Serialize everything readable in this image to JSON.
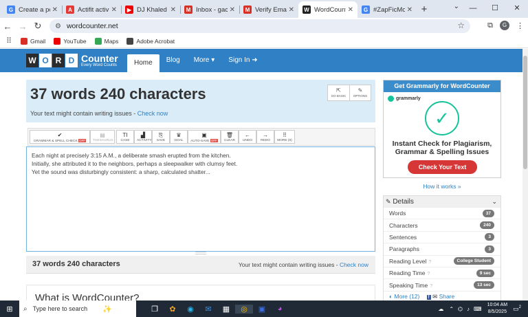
{
  "browser": {
    "tabs": [
      {
        "label": "Create a post",
        "icon": "google-docs-icon",
        "color": "#4285f4",
        "glyph": "G"
      },
      {
        "label": "Actifit activity",
        "icon": "actifit-icon",
        "color": "#e53935",
        "glyph": "A"
      },
      {
        "label": "DJ Khaled - Fr",
        "icon": "youtube-icon",
        "color": "#e00",
        "glyph": "▶"
      },
      {
        "label": "Inbox - gache",
        "icon": "gmail-icon",
        "color": "#d93025",
        "glyph": "M"
      },
      {
        "label": "Verify Email A",
        "icon": "gmail-icon",
        "color": "#d93025",
        "glyph": "M"
      },
      {
        "label": "WordCounte",
        "icon": "wordcounter-icon",
        "color": "#222",
        "glyph": "W",
        "active": true
      },
      {
        "label": "#ZapFicMonc",
        "icon": "google-icon",
        "color": "#4285f4",
        "glyph": "G"
      }
    ],
    "url": "wordcounter.net",
    "profile_initial": "G",
    "bookmarks": [
      {
        "label": "Gmail",
        "color": "#d93025"
      },
      {
        "label": "YouTube",
        "color": "#e00"
      },
      {
        "label": "Maps",
        "color": "#34a853"
      },
      {
        "label": "Adobe Acrobat",
        "color": "#444"
      }
    ]
  },
  "site": {
    "logo_letters": [
      "W",
      "O",
      "R",
      "D"
    ],
    "logo_counter": "Counter",
    "logo_tagline": "Every Word Counts",
    "nav": {
      "home": "Home",
      "blog": "Blog",
      "more": "More ▾",
      "signin": "Sign In ➜"
    }
  },
  "hero": {
    "heading": "37 words 240 characters",
    "warning_prefix": "Your text might contain writing issues - ",
    "warning_link": "Check now",
    "buttons": [
      {
        "label": "GO BASIC",
        "icon": "external-link-icon",
        "glyph": "⇱"
      },
      {
        "label": "OPTIONS",
        "icon": "wrench-icon",
        "glyph": "✎"
      }
    ]
  },
  "toolbar": {
    "grammar": "GRAMMAR & SPELL CHECK",
    "off": "OFF",
    "thesaurus": "THESAURUS",
    "case": "CASE",
    "activity": "ACTIVITY",
    "save": "SAVE",
    "goal": "GOAL",
    "autosave": "AUTO-SAVE",
    "clear": "CLEAR",
    "undo": "UNDO",
    "redo": "REDO",
    "more": "MORE (9)"
  },
  "editor": {
    "lines": [
      "Each night at precisely 3:15 A.M., a deliberate smash erupted from the kitchen.",
      "Initially, she attributed it to the neighbors, perhaps a sleepwalker with clumsy feet.",
      "Yet the sound was disturbingly consistent: a sharp, calculated shatter..."
    ]
  },
  "footer_bar": {
    "count": "37 words 240 characters",
    "warning_prefix": "Your text might contain writing issues - ",
    "warning_link": "Check now"
  },
  "whatis": {
    "heading": "What is WordCounter?"
  },
  "ad": {
    "header": "Get Grammarly for WordCounter",
    "brand": "grammarly",
    "title": "Instant Check for Plagiarism, Grammar & Spelling Issues",
    "button": "Check Your Text",
    "how": "How it works »"
  },
  "details": {
    "heading": "Details",
    "rows": [
      {
        "label": "Words",
        "value": "37",
        "help": false
      },
      {
        "label": "Characters",
        "value": "240",
        "help": false
      },
      {
        "label": "Sentences",
        "value": "3",
        "help": false
      },
      {
        "label": "Paragraphs",
        "value": "3",
        "help": false
      },
      {
        "label": "Reading Level",
        "value": "College Student",
        "help": true
      },
      {
        "label": "Reading Time",
        "value": "9 sec",
        "help": true
      },
      {
        "label": "Speaking Time",
        "value": "13 sec",
        "help": true
      }
    ],
    "more": "More (12)",
    "share": "Share"
  },
  "taskbar": {
    "search_placeholder": "Type here to search",
    "time": "10:04 AM",
    "date": "8/5/2025",
    "notifications": "2"
  }
}
